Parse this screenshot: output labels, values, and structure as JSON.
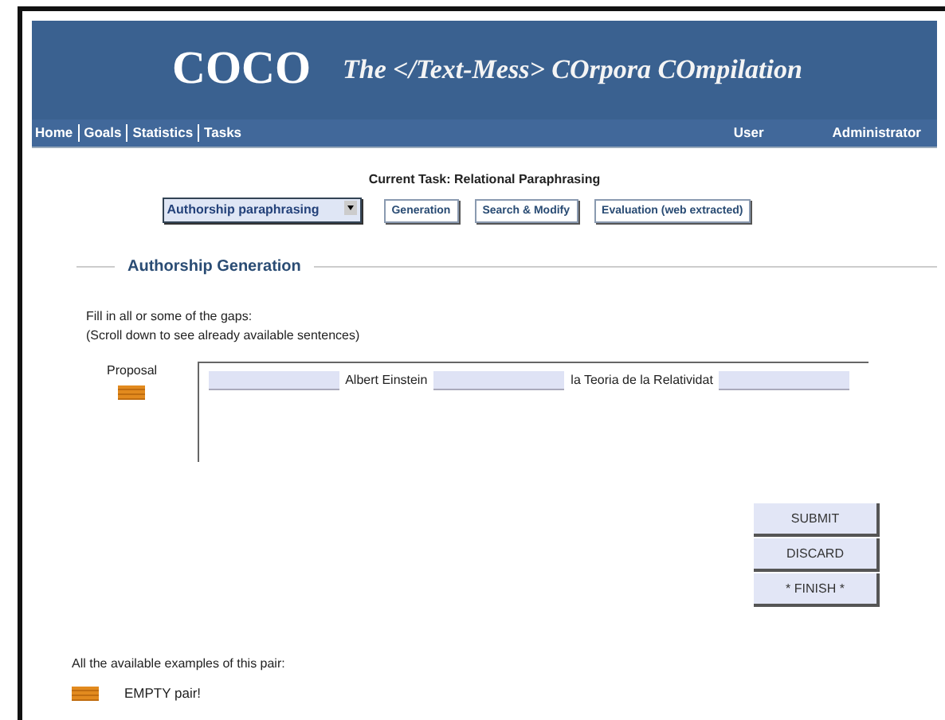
{
  "header": {
    "logo": "COCO",
    "subtitle": "The </Text-Mess> COrpora COmpilation"
  },
  "nav": {
    "links": [
      "Home",
      "Goals",
      "Statistics",
      "Tasks"
    ],
    "user_label": "User",
    "user_name": "Administrator"
  },
  "task": {
    "title": "Current Task: Relational Paraphrasing",
    "select_value": "Authorship paraphrasing",
    "buttons": [
      "Generation",
      "Search & Modify",
      "Evaluation (web extracted)"
    ]
  },
  "section": {
    "legend": "Authorship Generation",
    "instructions": [
      "Fill in all or some of the gaps:",
      "(Scroll down to see already available sentences)"
    ],
    "proposal_label": "Proposal",
    "sentence": [
      {
        "kind": "gap"
      },
      {
        "kind": "text",
        "text": "Albert Einstein"
      },
      {
        "kind": "gap"
      },
      {
        "kind": "text",
        "text": "la Teoria de la Relatividat"
      },
      {
        "kind": "gap"
      }
    ],
    "actions": [
      "SUBMIT",
      "DISCARD",
      "* FINISH *"
    ]
  },
  "examples": {
    "heading": "All the available examples of this pair:",
    "items": [
      "EMPTY pair!"
    ]
  }
}
